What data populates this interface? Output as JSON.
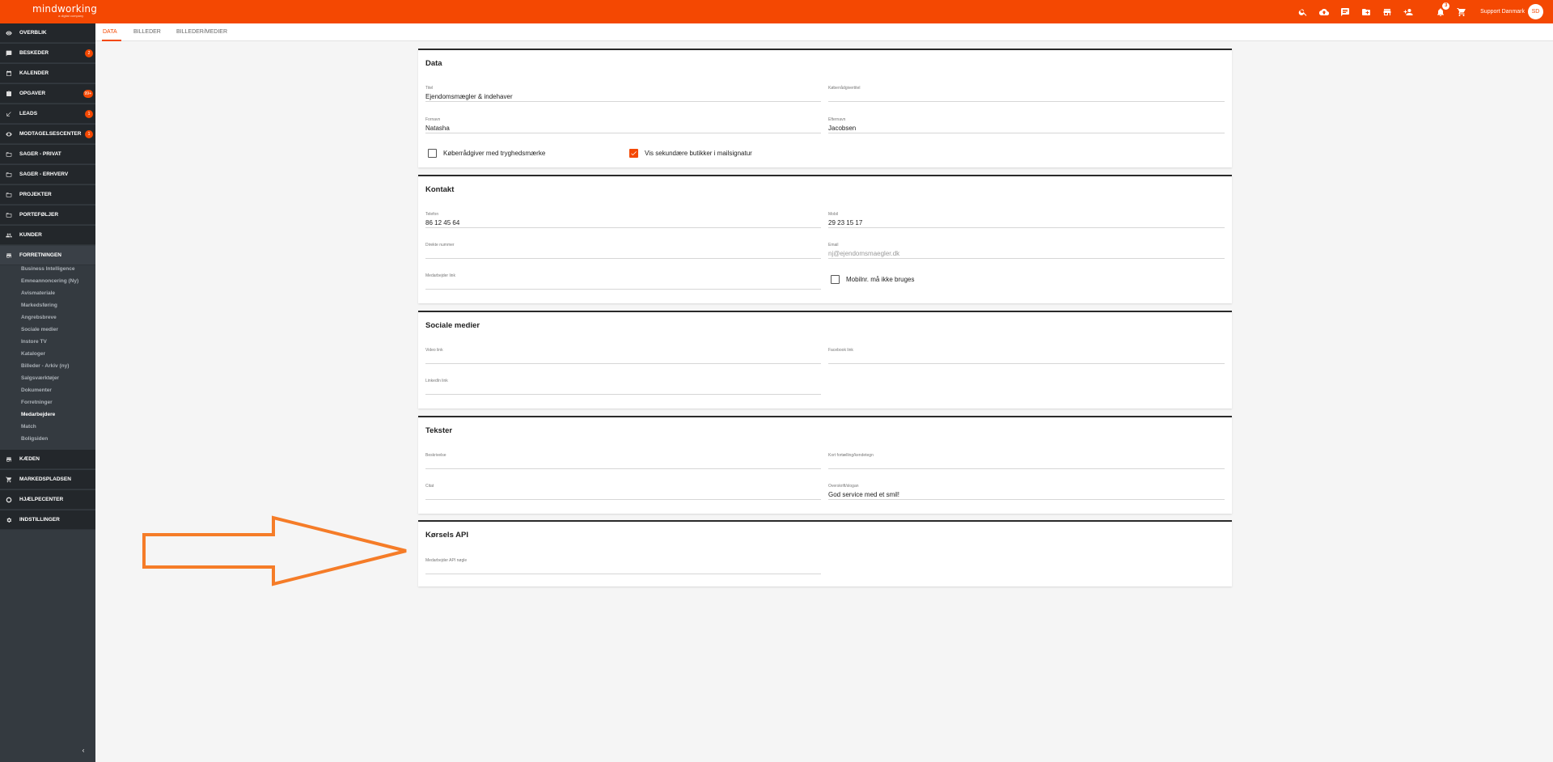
{
  "app": {
    "logo": "mindworking",
    "logo_sub": "a digital company",
    "user": "Support Danmark",
    "user_initials": "SD",
    "notifications": "3",
    "accent": "#f44802"
  },
  "sidebar": {
    "items": [
      {
        "label": "OVERBLIK",
        "icon": "eye-icon",
        "badge": ""
      },
      {
        "label": "BESKEDER",
        "icon": "message-icon",
        "badge": "2"
      },
      {
        "label": "KALENDER",
        "icon": "calendar-icon",
        "badge": ""
      },
      {
        "label": "OPGAVER",
        "icon": "clipboard-icon",
        "badge": "99+"
      },
      {
        "label": "LEADS",
        "icon": "arrow-in-icon",
        "badge": "1"
      },
      {
        "label": "MODTAGELSESCENTER",
        "icon": "eye-icon",
        "badge": "1"
      },
      {
        "label": "SAGER - PRIVAT",
        "icon": "folder-icon",
        "badge": ""
      },
      {
        "label": "SAGER - ERHVERV",
        "icon": "folder-icon",
        "badge": ""
      },
      {
        "label": "PROJEKTER",
        "icon": "folder-icon",
        "badge": ""
      },
      {
        "label": "PORTEFØLJER",
        "icon": "folder-icon",
        "badge": ""
      },
      {
        "label": "KUNDER",
        "icon": "people-icon",
        "badge": ""
      },
      {
        "label": "FORRETNINGEN",
        "icon": "store-icon",
        "badge": ""
      }
    ],
    "sub_items": [
      "Business Intelligence",
      "Emneannoncering (Ny)",
      "Avismateriale",
      "Markedsføring",
      "Angrebsbreve",
      "Sociale medier",
      "Instore TV",
      "Kataloger",
      "Billeder - Arkiv (ny)",
      "Salgsværktøjer",
      "Dokumenter",
      "Forretninger",
      "Medarbejdere",
      "Match",
      "Boligsiden"
    ],
    "bottom_items": [
      {
        "label": "KÆDEN",
        "icon": "chain-store-icon"
      },
      {
        "label": "MARKEDSPLADSEN",
        "icon": "cart-icon"
      },
      {
        "label": "HJÆLPECENTER",
        "icon": "help-icon"
      },
      {
        "label": "INDSTILLINGER",
        "icon": "gear-icon"
      }
    ]
  },
  "tabs": [
    "DATA",
    "BILLEDER",
    "BILLEDER/MEDIER"
  ],
  "sections": {
    "data": {
      "title": "Data",
      "titel_label": "Titel",
      "titel_value": "Ejendomsmægler & indehaver",
      "koberradgivertitel_label": "Køberrådgivertitel",
      "koberradgivertitel_value": "",
      "fornavn_label": "Fornavn",
      "fornavn_value": "Natasha",
      "efternavn_label": "Efternavn",
      "efternavn_value": "Jacobsen",
      "check1": "Køberrådgiver med tryghedsmærke",
      "check2": "Vis sekundære butikker i mailsignatur"
    },
    "kontakt": {
      "title": "Kontakt",
      "telefon_label": "Telefon",
      "telefon_value": "86 12 45 64",
      "mobil_label": "Mobil",
      "mobil_value": "29 23 15 17",
      "direkte_label": "Direkte nummer",
      "email_label": "Email",
      "email_value": "nj@ejendomsmaegler.dk",
      "link_label": "Medarbejder link",
      "check": "Mobilnr. må ikke bruges"
    },
    "sociale": {
      "title": "Sociale medier",
      "video_label": "Video link",
      "facebook_label": "Facebook link",
      "linkedin_label": "LinkedIn link"
    },
    "tekster": {
      "title": "Tekster",
      "beskrivelse_label": "Beskrivelse",
      "kort_label": "Kort fortælling/kendetegn",
      "citat_label": "Citat",
      "overskrift_label": "Overskrift/slogan",
      "overskrift_value": "God service med et smil!"
    },
    "korsels": {
      "title": "Kørsels API",
      "api_label": "Medarbejder API nøgle"
    }
  }
}
